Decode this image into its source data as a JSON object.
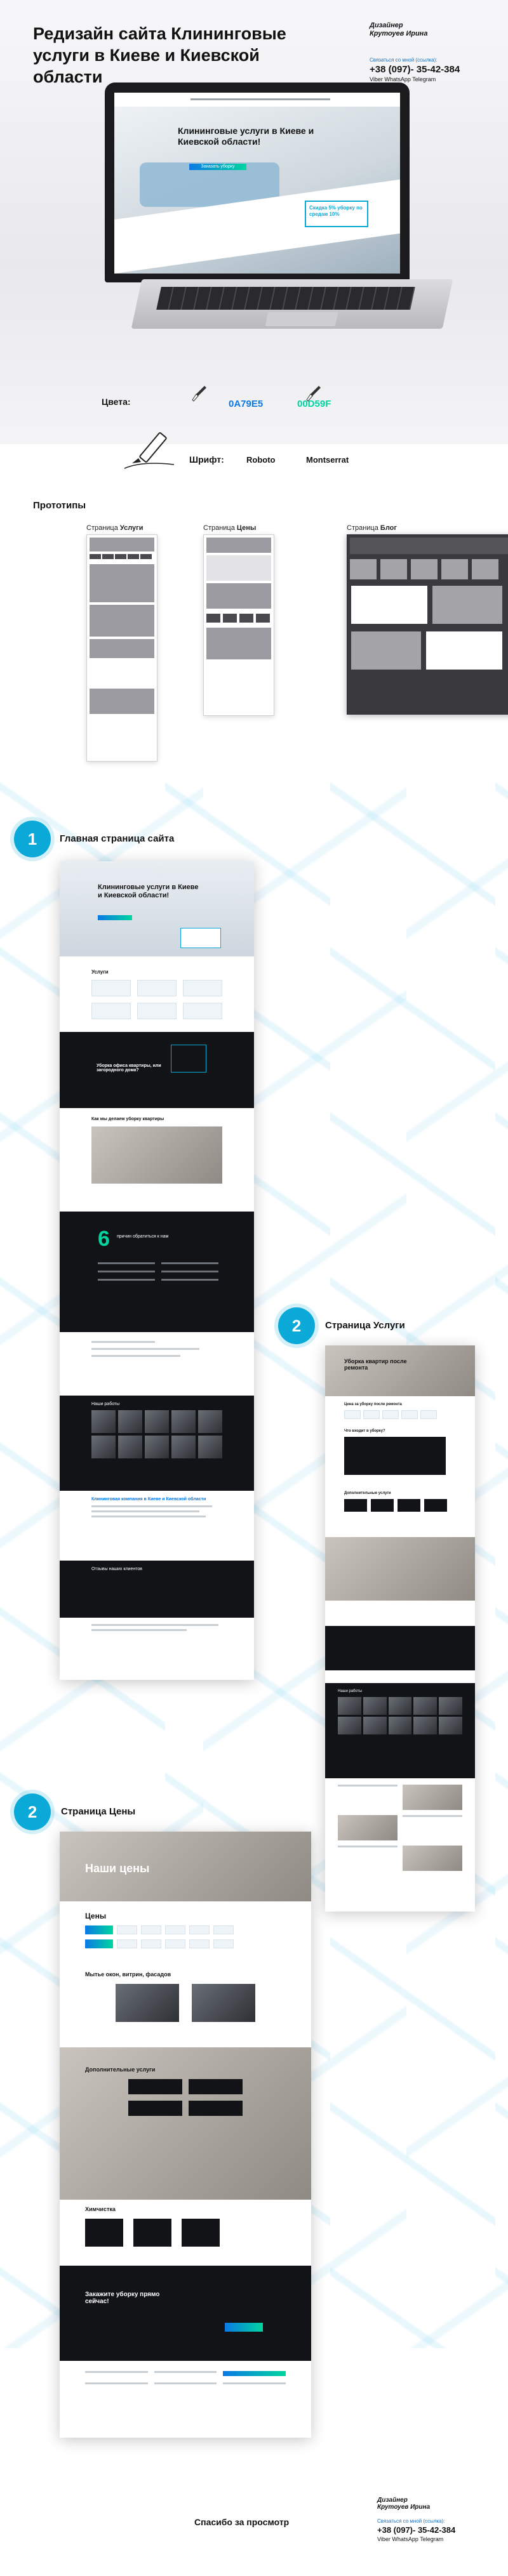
{
  "header": {
    "title": "Редизайн сайта Клининговые услуги в Киеве и Киевской области",
    "designer_line1": "Дизайнер",
    "designer_line2": "Крутоуев Ирина",
    "contact_caption": "Связаться со мной (ссылка):",
    "phone": "+38 (097)- 35-42-384",
    "contact_links": "Viber  WhatsApp  Telegram"
  },
  "laptop_screen": {
    "headline": "Клининговые услуги в Киеве и Киевской области!",
    "offer": "Скидка 5% уборку по средам 10%",
    "cta": "Заказать уборку"
  },
  "colors": {
    "label": "Цвета:",
    "primary_hex": "0A79E5",
    "secondary_hex": "00D59F",
    "primary": "#0a79e5",
    "secondary": "#00d59f"
  },
  "fonts": {
    "label": "Шрифт:",
    "font_a": "Roboto",
    "font_b": "Montserrat"
  },
  "prototypes": {
    "title": "Прототипы",
    "captions": [
      {
        "prefix": "Страница",
        "name": "Услуги"
      },
      {
        "prefix": "Страница",
        "name": "Цены"
      },
      {
        "prefix": "Страница",
        "name": "Блог"
      }
    ]
  },
  "sections": {
    "main": {
      "number": "1",
      "title": "Главная страница сайта"
    },
    "services": {
      "number": "2",
      "title": "Страница Услуги"
    },
    "prices": {
      "number": "2",
      "title": "Страница Цены"
    }
  },
  "main_mock": {
    "headline": "Клининговые услуги в Киеве и Киевской области!",
    "services_heading": "Услуги",
    "dark_heading": "Уборка офиса квартиры, или загородного дома?",
    "how_heading": "Как мы делаем уборку квартиры",
    "six": "6",
    "six_text": "причин обратиться к нам",
    "works_heading": "Наши работы",
    "contacts_heading": "Клининговая компания в Киеве и Киевской области",
    "reviews_heading": "Отзывы наших клиентов"
  },
  "services_mock": {
    "headline": "Уборка квартир после ремонта",
    "text_a": "Цена за уборку после ремонта",
    "text_b": "Что входит в уборку?",
    "extras": "Дополнительные услуги",
    "works": "Наши работы"
  },
  "prices_mock": {
    "headline": "Наши цены",
    "prices_label": "Цены",
    "windows": "Мытье окон, витрин, фасадов",
    "extras": "Дополнительные услуги",
    "dryclean": "Химчистка",
    "order": "Закажите уборку прямо сейчас!"
  },
  "footer": {
    "thanks": "Спасибо за просмотр",
    "designer_line1": "Дизайнер",
    "designer_line2": "Крутоуев Ирина",
    "contact_caption": "Связаться со мной (ссылка):",
    "phone": "+38 (097)- 35-42-384",
    "contact_links": "Viber  WhatsApp  Telegram"
  }
}
